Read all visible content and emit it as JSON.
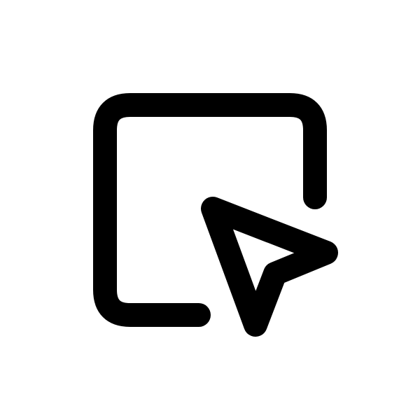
{
  "icon": {
    "name": "select-window-pointer-icon",
    "stroke_color": "#000000",
    "background_color": "#ffffff"
  }
}
